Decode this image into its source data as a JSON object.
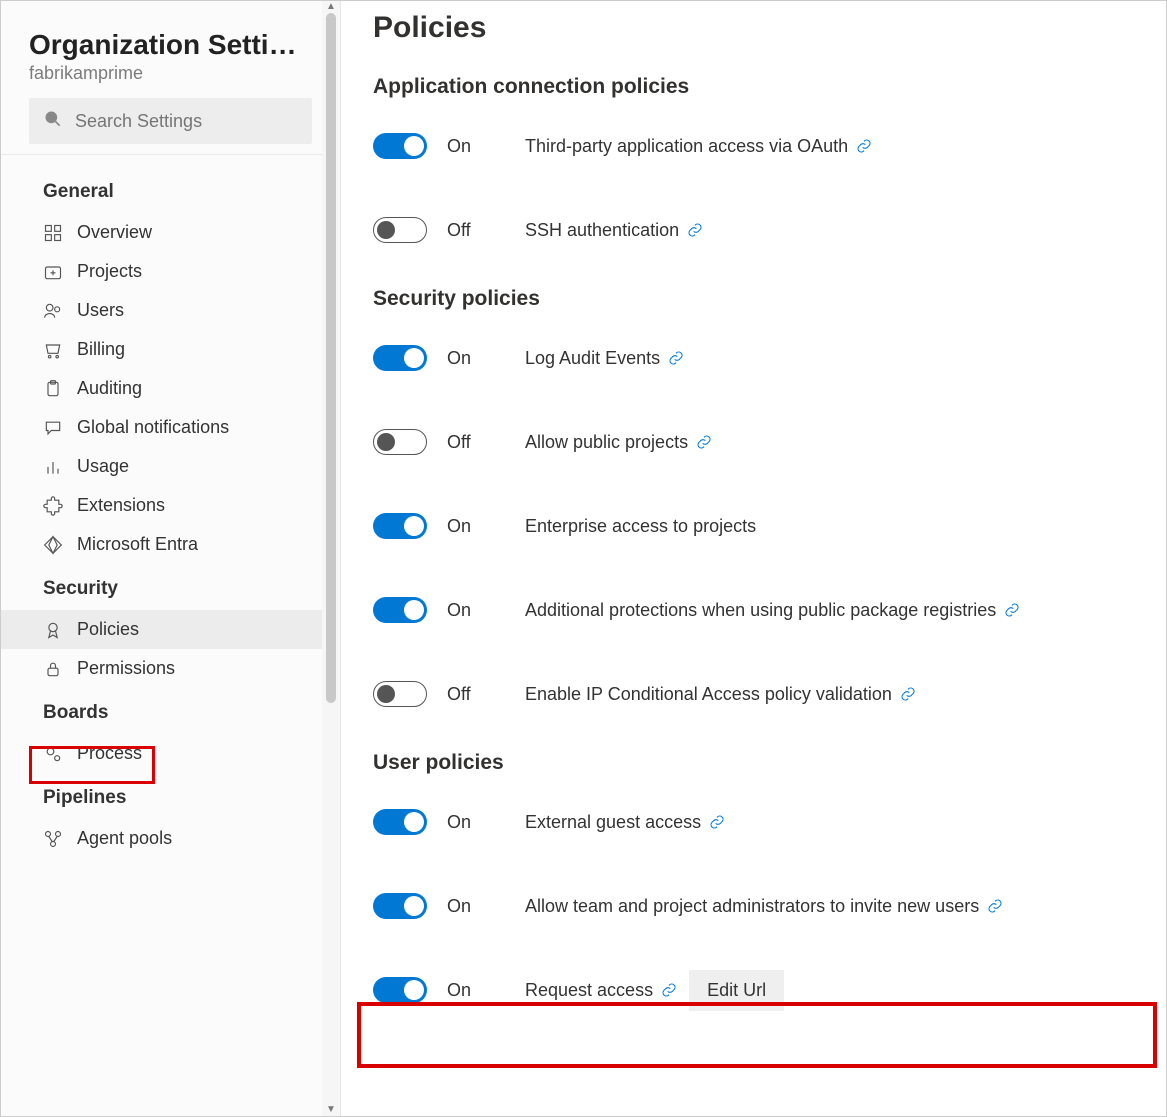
{
  "sidebar": {
    "title": "Organization Settin…",
    "subtitle": "fabrikamprime",
    "search_placeholder": "Search Settings",
    "groups": [
      {
        "heading": "General",
        "items": [
          {
            "name": "overview",
            "label": "Overview",
            "icon": "grid"
          },
          {
            "name": "projects",
            "label": "Projects",
            "icon": "folder-plus"
          },
          {
            "name": "users",
            "label": "Users",
            "icon": "users"
          },
          {
            "name": "billing",
            "label": "Billing",
            "icon": "cart"
          },
          {
            "name": "auditing",
            "label": "Auditing",
            "icon": "clipboard"
          },
          {
            "name": "global-notifications",
            "label": "Global notifications",
            "icon": "chat"
          },
          {
            "name": "usage",
            "label": "Usage",
            "icon": "bar-chart"
          },
          {
            "name": "extensions",
            "label": "Extensions",
            "icon": "puzzle"
          },
          {
            "name": "microsoft-entra",
            "label": "Microsoft Entra",
            "icon": "diamond"
          }
        ]
      },
      {
        "heading": "Security",
        "items": [
          {
            "name": "policies",
            "label": "Policies",
            "icon": "ribbon",
            "selected": true
          },
          {
            "name": "permissions",
            "label": "Permissions",
            "icon": "lock"
          }
        ]
      },
      {
        "heading": "Boards",
        "items": [
          {
            "name": "process",
            "label": "Process",
            "icon": "gears"
          }
        ]
      },
      {
        "heading": "Pipelines",
        "items": [
          {
            "name": "agent-pools",
            "label": "Agent pools",
            "icon": "nodes"
          }
        ]
      }
    ]
  },
  "main": {
    "title": "Policies",
    "labels": {
      "on": "On",
      "off": "Off",
      "edit_url": "Edit Url"
    },
    "sections": [
      {
        "heading": "Application connection policies",
        "rows": [
          {
            "id": "oauth",
            "on": true,
            "label": "Third-party application access via OAuth",
            "link": true
          },
          {
            "id": "ssh",
            "on": false,
            "label": "SSH authentication",
            "link": true
          }
        ]
      },
      {
        "heading": "Security policies",
        "rows": [
          {
            "id": "audit",
            "on": true,
            "label": "Log Audit Events",
            "link": true
          },
          {
            "id": "public",
            "on": false,
            "label": "Allow public projects",
            "link": true
          },
          {
            "id": "ent",
            "on": true,
            "label": "Enterprise access to projects",
            "link": false
          },
          {
            "id": "pkg",
            "on": true,
            "label": "Additional protections when using public package registries",
            "link": true
          },
          {
            "id": "ipca",
            "on": false,
            "label": "Enable IP Conditional Access policy validation",
            "link": true
          }
        ]
      },
      {
        "heading": "User policies",
        "rows": [
          {
            "id": "guest",
            "on": true,
            "label": "External guest access",
            "link": true
          },
          {
            "id": "invite",
            "on": true,
            "label": "Allow team and project administrators to invite new users",
            "link": true
          },
          {
            "id": "req",
            "on": true,
            "label": "Request access",
            "link": true,
            "edit_url": true
          }
        ]
      }
    ]
  }
}
